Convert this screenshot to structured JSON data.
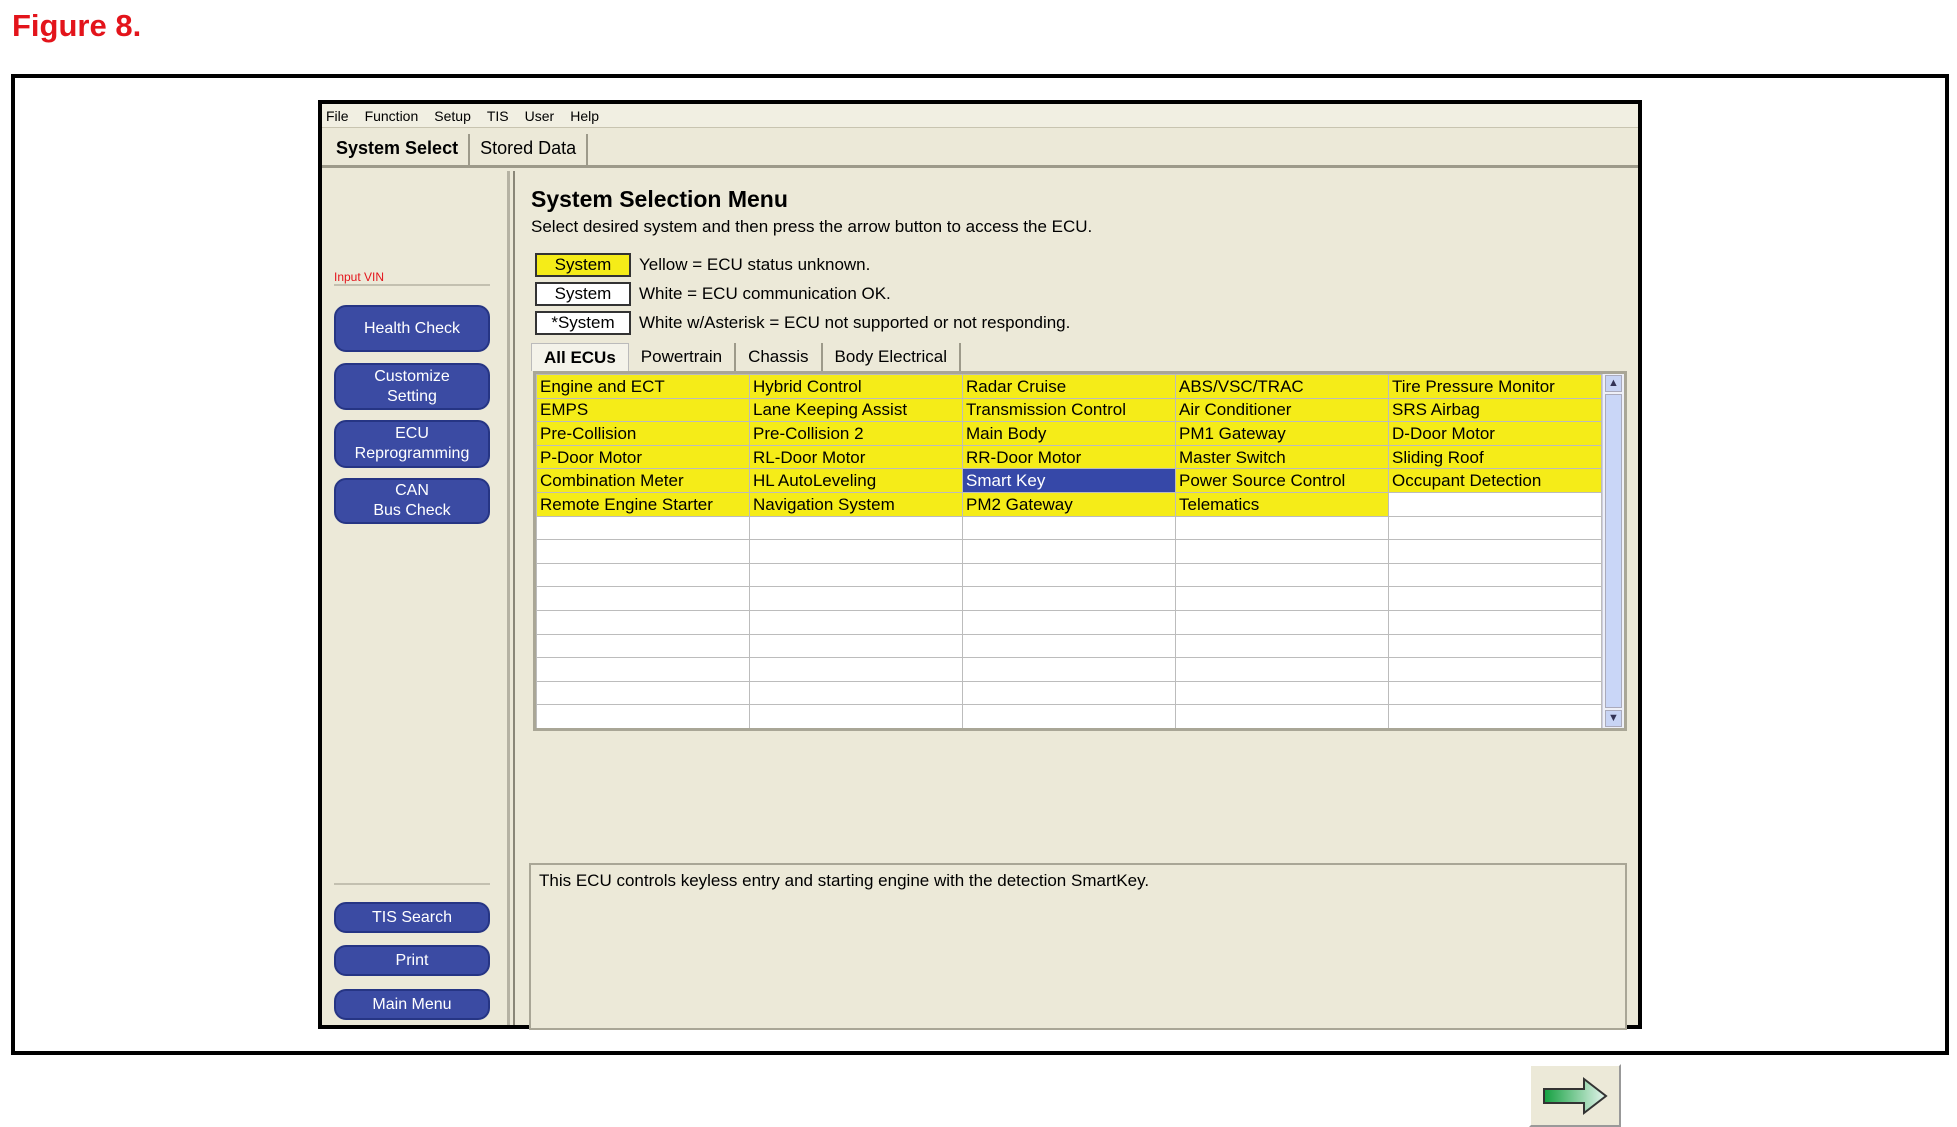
{
  "figure_label": "Figure 8.",
  "menu": [
    "File",
    "Function",
    "Setup",
    "TIS",
    "User",
    "Help"
  ],
  "top_tabs": [
    "System Select",
    "Stored Data"
  ],
  "sidebar": {
    "input_vin": "Input VIN",
    "buttons_top": [
      [
        "Health Check"
      ],
      [
        "Customize",
        "Setting"
      ],
      [
        "ECU",
        "Reprogramming"
      ],
      [
        "CAN",
        "Bus Check"
      ]
    ],
    "buttons_bottom": [
      "TIS Search",
      "Print",
      "Main Menu"
    ]
  },
  "main": {
    "title": "System Selection Menu",
    "subtitle": "Select desired system and then press the arrow button to access the ECU.",
    "legend": [
      {
        "box": "System",
        "text": "Yellow = ECU status unknown.",
        "color": "#f5ec18"
      },
      {
        "box": "System",
        "text": "White = ECU communication OK.",
        "color": "#ffffff"
      },
      {
        "box": "*System",
        "text": "White w/Asterisk = ECU not supported or not responding.",
        "color": "#ffffff"
      }
    ],
    "ecu_tabs": [
      "All ECUs",
      "Powertrain",
      "Chassis",
      "Body Electrical"
    ],
    "ecus": [
      [
        "Engine and ECT",
        "Hybrid Control",
        "Radar Cruise",
        "ABS/VSC/TRAC",
        "Tire Pressure Monitor"
      ],
      [
        "EMPS",
        "Lane Keeping Assist",
        "Transmission Control",
        "Air Conditioner",
        "SRS Airbag"
      ],
      [
        "Pre-Collision",
        "Pre-Collision 2",
        "Main Body",
        "PM1 Gateway",
        "D-Door Motor"
      ],
      [
        "P-Door Motor",
        "RL-Door Motor",
        "RR-Door Motor",
        "Master Switch",
        "Sliding Roof"
      ],
      [
        "Combination Meter",
        "HL AutoLeveling",
        "Smart Key",
        "Power Source Control",
        "Occupant Detection"
      ],
      [
        "Remote Engine Starter",
        "Navigation System",
        "PM2 Gateway",
        "Telematics",
        ""
      ]
    ],
    "selected_ecu": "Smart Key",
    "description": "This ECU controls keyless entry and starting engine with the detection SmartKey."
  }
}
